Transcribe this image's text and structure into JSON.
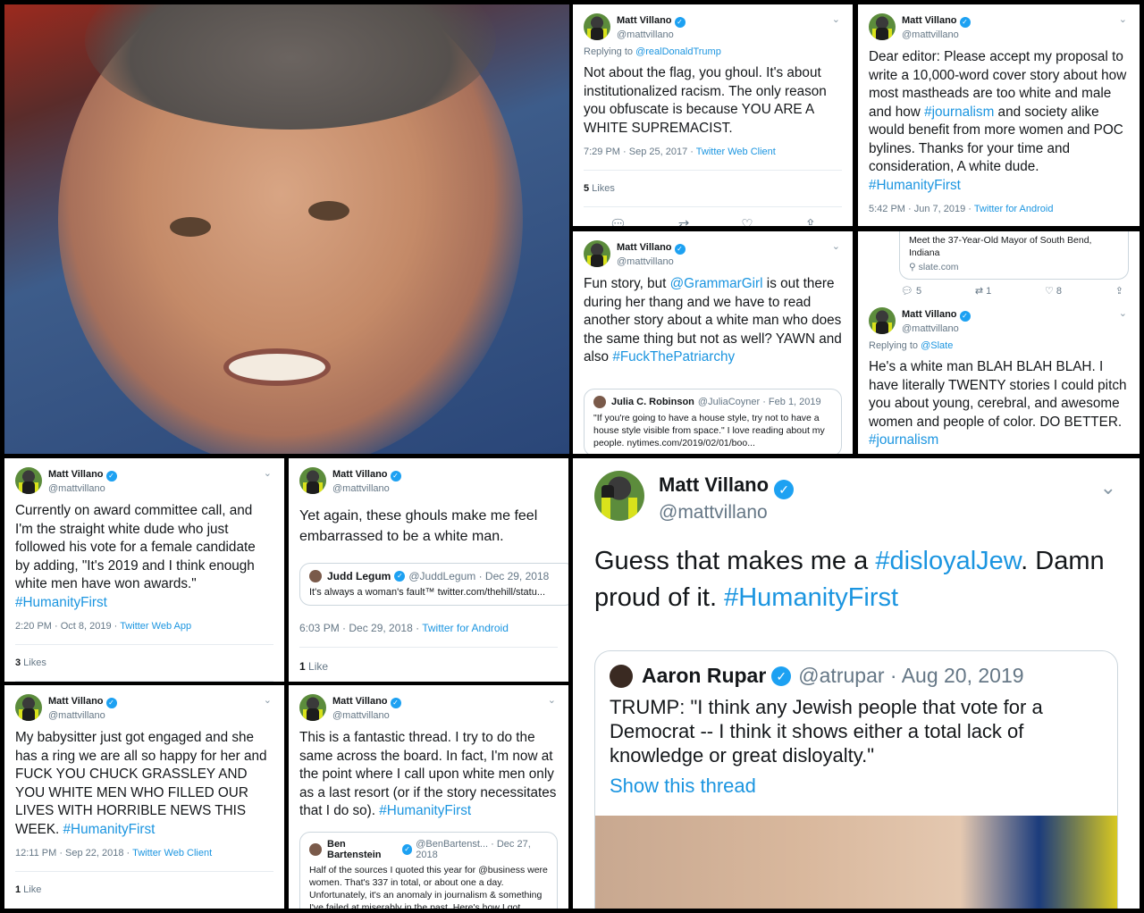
{
  "panel1": {},
  "panel2": {
    "name": "Matt Villano",
    "handle": "@mattvillano",
    "replying_prefix": "Replying to ",
    "replying_to": "@realDonaldTrump",
    "text": "Not about the flag, you ghoul. It's about institutionalized racism. The only reason you obfuscate is because YOU ARE A WHITE SUPREMACIST.",
    "timestamp": "7:29 PM · Sep 25, 2017 · ",
    "client": "Twitter Web Client",
    "likes_count": "5",
    "likes_label": " Likes"
  },
  "panel3": {
    "name": "Matt Villano",
    "handle": "@mattvillano",
    "text": "Dear editor: Please accept my proposal to write a 10,000-word cover story about how most mastheads are too white and male and how ",
    "hashtag1": "#journalism",
    "text2": " and society alike would benefit from more women and POC bylines. Thanks for your time and consideration, A white dude.",
    "hashtag2": "#HumanityFirst",
    "timestamp": "5:42 PM · Jun 7, 2019 · ",
    "client": "Twitter for Android"
  },
  "panel4": {
    "name": "Matt Villano",
    "handle": "@mattvillano",
    "text1": "Fun story, but ",
    "mention": "@GrammarGirl",
    "text2": " is out there during her thang and we have to read another story about a white man who does the same thing but not as well? YAWN and also ",
    "hashtag": "#FuckThePatriarchy",
    "quote_name": "Julia C. Robinson",
    "quote_meta": "@JuliaCoyner · Feb 1, 2019",
    "quote_text": "\"If you're going to have a house style, try not to have a house style visible from space.\" I love reading about my people. nytimes.com/2019/02/01/boo..."
  },
  "panel5": {
    "card_title": "Meet the 37-Year-Old Mayor of South Bend, Indiana",
    "card_domain": "slate.com",
    "replies": "5",
    "retweets": "1",
    "likes": "8",
    "name": "Matt Villano",
    "handle": "@mattvillano",
    "replying_prefix": "Replying to ",
    "replying_to": "@Slate",
    "text": "He's a white man BLAH BLAH BLAH. I have literally TWENTY stories I could pitch you about young, cerebral, and awesome women and people of color. DO BETTER.",
    "hashtag": "#journalism"
  },
  "panel6": {
    "name": "Matt Villano",
    "handle": "@mattvillano",
    "text": "Currently on award committee call, and I'm the straight white dude who just followed his vote for a female candidate by adding, \"It's 2019 and I think enough white men have won awards.\" ",
    "hashtag": "#HumanityFirst",
    "timestamp": "2:20 PM · Oct 8, 2019 · ",
    "client": "Twitter Web App",
    "likes_count": "3",
    "likes_label": " Likes"
  },
  "panel7": {
    "name": "Matt Villano",
    "handle": "@mattvillano",
    "text": "Yet again, these ghouls make me feel embarrassed to be a white man.",
    "quote_name": "Judd Legum",
    "quote_meta": "@JuddLegum · Dec 29, 2018",
    "quote_text": "It's always a woman's fault™ twitter.com/thehill/statu...",
    "timestamp": "6:03 PM · Dec 29, 2018 · ",
    "client": "Twitter for Android",
    "likes_count": "1",
    "likes_label": " Like"
  },
  "panel8": {
    "name": "Matt Villano",
    "handle": "@mattvillano",
    "text": "Guess that makes me a ",
    "hashtag1": "#disloyalJew",
    "text2": ". Damn proud of it. ",
    "hashtag2": "#HumanityFirst",
    "quote_name": "Aaron Rupar",
    "quote_meta": "@atrupar · Aug 20, 2019",
    "quote_text": "TRUMP: \"I think any Jewish people that vote for a Democrat -- I think it shows either a total lack of knowledge or great disloyalty.\"",
    "show_thread": "Show this thread"
  },
  "panel9": {
    "name": "Matt Villano",
    "handle": "@mattvillano",
    "text": "My babysitter just got engaged and she has a ring we are all so happy for her and FUCK YOU CHUCK GRASSLEY AND YOU WHITE MEN WHO FILLED OUR LIVES WITH HORRIBLE NEWS THIS WEEK. ",
    "hashtag": "#HumanityFirst",
    "timestamp": "12:11 PM · Sep 22, 2018 · ",
    "client": "Twitter Web Client",
    "likes_count": "1",
    "likes_label": " Like"
  },
  "panel10": {
    "name": "Matt Villano",
    "handle": "@mattvillano",
    "text": "This is a fantastic thread. I try to do the same across the board. In fact, I'm now at the point where I call upon white men only as a last resort (or if the story necessitates that I do so). ",
    "hashtag": "#HumanityFirst",
    "quote_name": "Ben Bartenstein",
    "quote_meta": "@BenBartenst... · Dec 27, 2018",
    "quote_text": "Half of the sources I quoted this year for @business were women. That's 337 in total, or about one a day. Unfortunately, it's an anomaly in journalism & something I've failed at miserably in the past. Here's how I got"
  },
  "icons": {
    "reply": "reply-icon",
    "retweet": "retweet-icon",
    "like": "heart-icon",
    "share": "share-icon",
    "verified": "verified-badge-icon",
    "chevron": "chevron-down-icon"
  },
  "colors": {
    "link": "#1b95e0",
    "verified": "#1da1f2",
    "border": "#000000"
  }
}
